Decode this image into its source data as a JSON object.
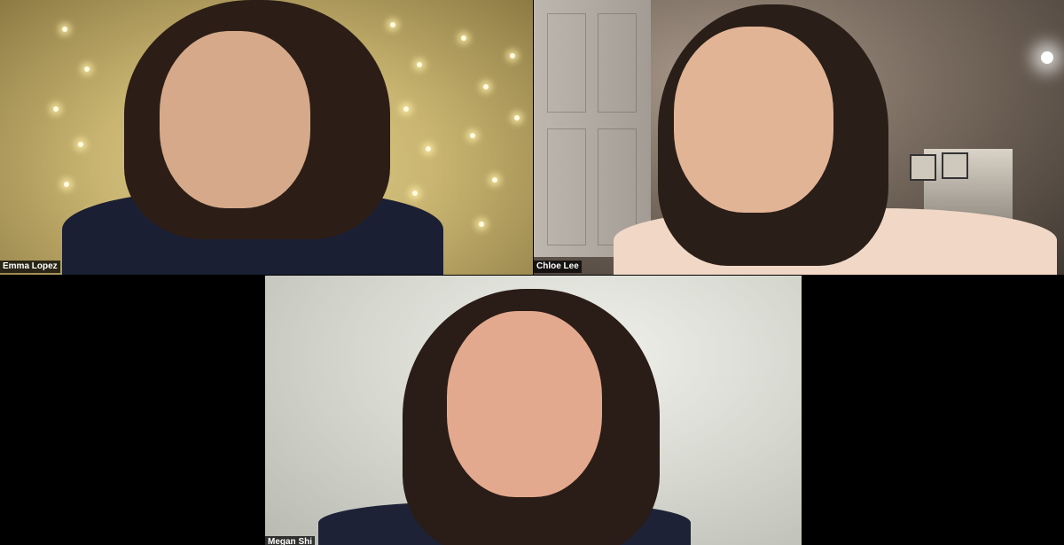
{
  "participants": [
    {
      "name": "Emma Lopez"
    },
    {
      "name": "Chloe Lee"
    },
    {
      "name": "Megan Shi"
    }
  ]
}
